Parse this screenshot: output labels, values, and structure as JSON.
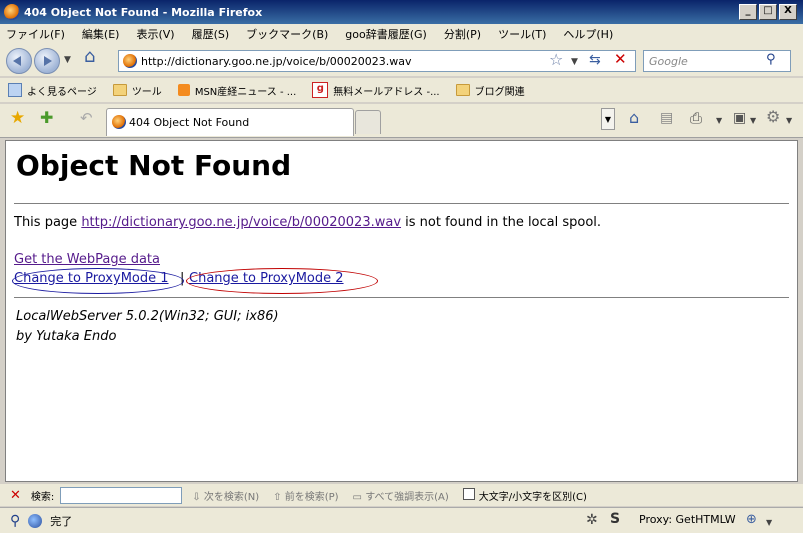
{
  "window": {
    "title": "404 Object Not Found - Mozilla Firefox",
    "min": "_",
    "max": "□",
    "close": "X"
  },
  "menu": [
    "ファイル(F)",
    "編集(E)",
    "表示(V)",
    "履歴(S)",
    "ブックマーク(B)",
    "goo辞書履歴(G)",
    "分割(P)",
    "ツール(T)",
    "ヘルプ(H)"
  ],
  "nav": {
    "url": "http://dictionary.goo.ne.jp/voice/b/00020023.wav",
    "search_placeholder": "Google"
  },
  "bookmarks": [
    "よく見るページ",
    "ツール",
    "MSN産経ニュース - ...",
    "無料メールアドレス -...",
    "ブログ関連"
  ],
  "tab": {
    "title": "404 Object Not Found"
  },
  "page": {
    "heading": "Object Not Found",
    "text_before": "This page ",
    "link_url": "http://dictionary.goo.ne.jp/voice/b/00020023.wav",
    "text_after": " is not found in the local spool.",
    "get_data": "Get the WebPage data",
    "proxy1": "Change to ProxyMode 1",
    "separator": "|",
    "proxy2": "Change to ProxyMode 2",
    "server": "LocalWebServer 5.0.2(Win32; GUI; ix86)",
    "author": "by Yutaka Endo",
    "annotation_colors": {
      "proxy1": "#1a1aa0",
      "proxy2": "#c00000"
    }
  },
  "findbar": {
    "label": "検索:",
    "next": "次を検索(N)",
    "prev": "前を検索(P)",
    "highlight": "すべて強調表示(A)",
    "match_case": "大文字/小文字を区別(C)"
  },
  "status": {
    "text": "完了",
    "proxy": "Proxy: GetHTMLW"
  }
}
